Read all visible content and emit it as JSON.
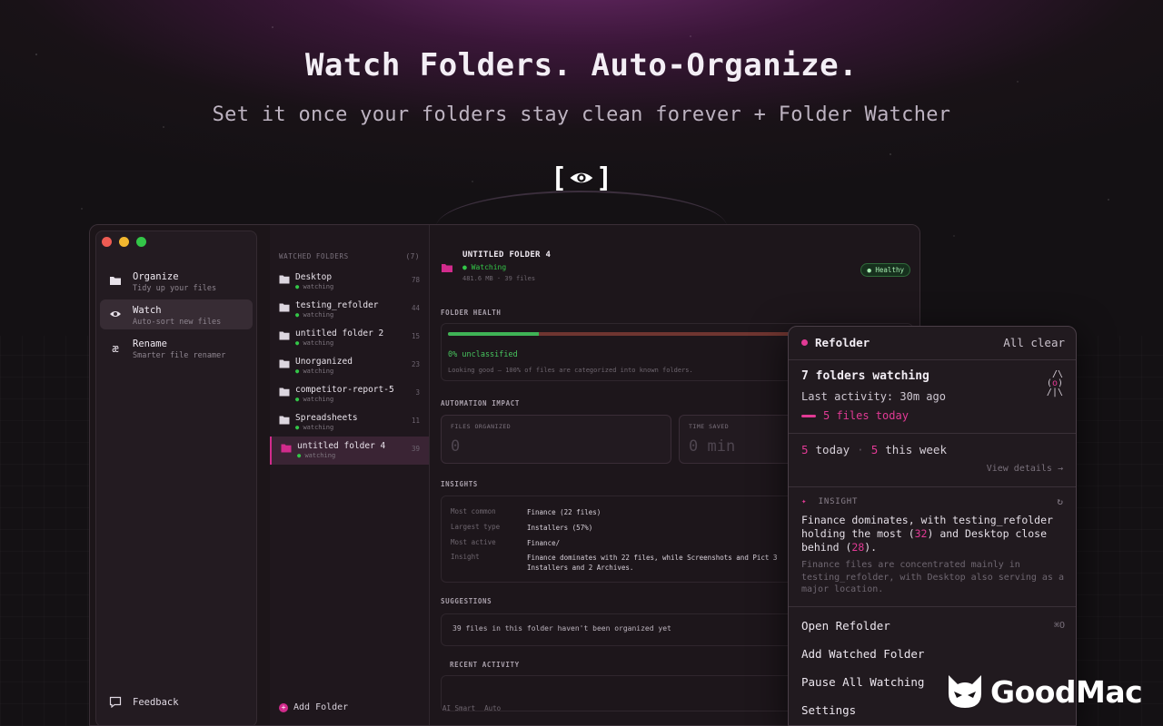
{
  "hero": {
    "title": "Watch Folders. Auto-Organize.",
    "subtitle": "Set it once your folders stay clean forever + Folder Watcher",
    "eye_left_bracket": "[",
    "eye_right_bracket": "]"
  },
  "sidebar": {
    "items": [
      {
        "title": "Organize",
        "subtitle": "Tidy up your files",
        "icon": "folder-icon"
      },
      {
        "title": "Watch",
        "subtitle": "Auto-sort new files",
        "icon": "eye-icon"
      },
      {
        "title": "Rename",
        "subtitle": "Smarter file renamer",
        "icon": "ae-icon"
      }
    ],
    "feedback": "Feedback"
  },
  "folders": {
    "header": "WATCHED FOLDERS",
    "count": "(7)",
    "status_label": "watching",
    "items": [
      {
        "name": "Desktop",
        "count": "78"
      },
      {
        "name": "testing_refolder",
        "count": "44"
      },
      {
        "name": "untitled folder 2",
        "count": "15"
      },
      {
        "name": "Unorganized",
        "count": "23"
      },
      {
        "name": "competitor-report-5",
        "count": "3"
      },
      {
        "name": "Spreadsheets",
        "count": "11"
      },
      {
        "name": "untitled folder 4",
        "count": "39"
      }
    ],
    "add_label": "Add Folder"
  },
  "main": {
    "title": "UNTITLED FOLDER 4",
    "status": "Watching",
    "meta": "481.6 MB · 39 files",
    "badge": "Healthy",
    "health_section": "FOLDER HEALTH",
    "health_fraction": 0.2,
    "unclassified": "0% unclassified",
    "health_note": "Looking good — 100% of files are categorized into known folders.",
    "automation_section": "AUTOMATION IMPACT",
    "files_organized_label": "FILES ORGANIZED",
    "files_organized_value": "0",
    "time_saved_label": "TIME SAVED",
    "time_saved_value": "0 min",
    "insights_section": "INSIGHTS",
    "insights": [
      {
        "key": "Most common",
        "value": "Finance (22 files)"
      },
      {
        "key": "Largest type",
        "value": "Installers (57%)"
      },
      {
        "key": "Most active",
        "value": "Finance/"
      },
      {
        "key": "Insight",
        "value": "Finance dominates with 22 files, while Screenshots and Pict 3 Installers and 2 Archives."
      }
    ],
    "suggestions_section": "SUGGESTIONS",
    "suggestion": "39 files in this folder haven't been organized yet",
    "recent_section": "RECENT ACTIVITY",
    "footer_ai": "AI Smart",
    "footer_auto": "Auto"
  },
  "popover": {
    "brand": "Refolder",
    "all_clear": "All clear",
    "watching": "7 folders watching",
    "last_activity": "Last activity: 30m ago",
    "files_today": "5 files today",
    "today_num": "5",
    "today_label": "today",
    "week_num": "5",
    "week_label": "this week",
    "view_details": "View details →",
    "insight_label": "INSIGHT",
    "insight_text_1": "Finance dominates, with testing_refolder holding the most (",
    "insight_num_1": "32",
    "insight_text_2": ") and Desktop close behind (",
    "insight_num_2": "28",
    "insight_text_3": ").",
    "insight_note": "Finance files are concentrated mainly in testing_refolder, with Desktop also serving as a major location.",
    "menu": [
      {
        "label": "Open Refolder",
        "shortcut": "⌘O"
      },
      {
        "label": "Add Watched Folder",
        "shortcut": ""
      },
      {
        "label": "Pause All Watching",
        "shortcut": ""
      },
      {
        "label": "Settings",
        "shortcut": ""
      }
    ]
  },
  "watermark": "GoodMac",
  "colors": {
    "accent": "#e23a95",
    "success": "#33c648",
    "background": "#161215"
  }
}
